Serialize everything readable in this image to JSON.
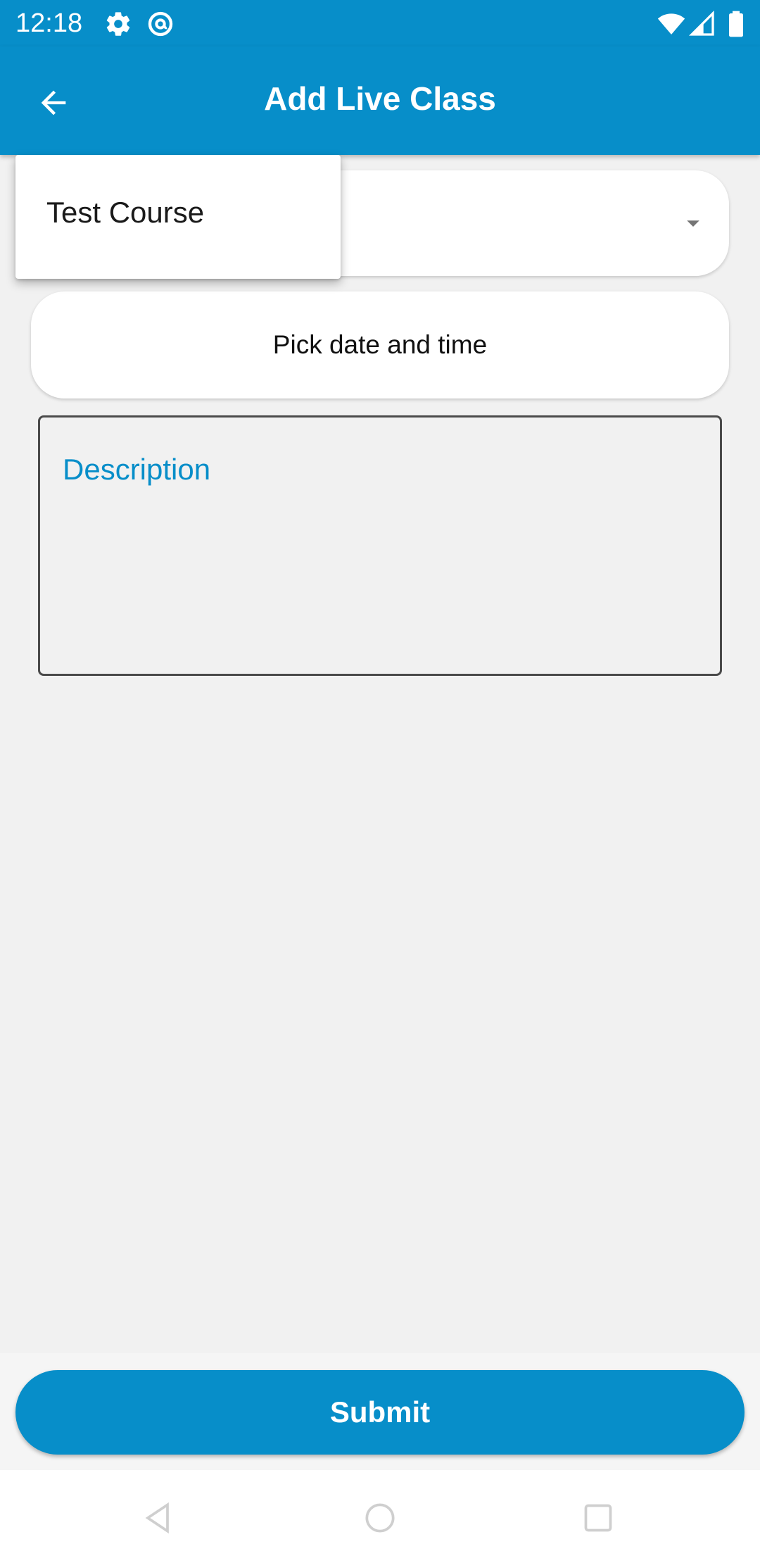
{
  "status_bar": {
    "time": "12:18",
    "icons": [
      "gear-icon",
      "at-sign-icon",
      "wifi-icon",
      "signal-icon",
      "battery-icon"
    ]
  },
  "app_bar": {
    "title": "Add Live Class",
    "back_icon": "arrow-left-icon"
  },
  "form": {
    "course_dropdown": {
      "selected": "",
      "arrow_icon": "caret-down-icon"
    },
    "date_picker_label": "Pick date and time",
    "description_label": "Description"
  },
  "popup_menu": {
    "items": [
      {
        "label": "Test Course"
      }
    ]
  },
  "actions": {
    "submit_label": "Submit"
  },
  "colors": {
    "primary": "#078ec9",
    "background": "#f1f1f1",
    "field_bg": "#ffffff"
  }
}
